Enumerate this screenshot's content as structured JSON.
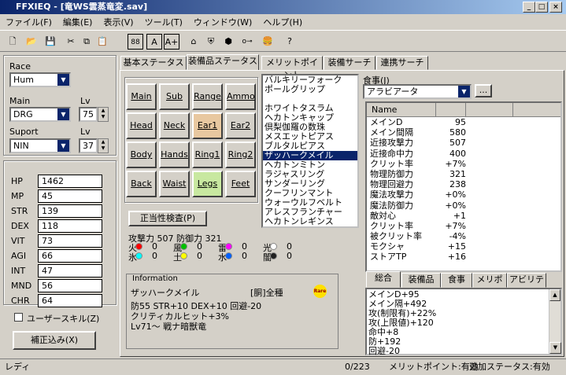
{
  "window": {
    "title": "FFXIEQ - [竜WS雲蒸竜変.sav]"
  },
  "menu": [
    "ファイル(F)",
    "編集(E)",
    "表示(V)",
    "ツール(T)",
    "ウィンドウ(W)",
    "ヘルプ(H)"
  ],
  "toolbar": {
    "b88": "88",
    "bA": "A",
    "bAplus": "A+"
  },
  "left": {
    "race_label": "Race",
    "race": "Hum",
    "main_label": "Main",
    "main": "DRG",
    "lv_label": "Lv",
    "main_lv": "75",
    "support_label": "Suport",
    "support": "NIN",
    "support_lv": "37",
    "stats": [
      {
        "k": "HP",
        "v": "1462"
      },
      {
        "k": "MP",
        "v": "45"
      },
      {
        "k": "STR",
        "v": "139"
      },
      {
        "k": "DEX",
        "v": "118"
      },
      {
        "k": "VIT",
        "v": "73"
      },
      {
        "k": "AGI",
        "v": "66"
      },
      {
        "k": "INT",
        "v": "47"
      },
      {
        "k": "MND",
        "v": "56"
      },
      {
        "k": "CHR",
        "v": "64"
      }
    ],
    "user_skill": "ユーザースキル(Z)",
    "correct_btn": "補正込み(X)"
  },
  "tabs": [
    "基本ステータス",
    "装備品ステータス",
    "メリットポイント",
    "装備サーチ",
    "連携サーチ"
  ],
  "slots": [
    [
      "Main",
      "Sub",
      "Range",
      "Ammo"
    ],
    [
      "Head",
      "Neck",
      "Ear1",
      "Ear2"
    ],
    [
      "Body",
      "Hands",
      "Ring1",
      "Ring2"
    ],
    [
      "Back",
      "Waist",
      "Legs",
      "Feet"
    ]
  ],
  "check_btn": "正当性検査(P)",
  "atk_def": "攻撃力 507 防御力 321",
  "elements": [
    {
      "n": "火",
      "v": "0",
      "c": "#ff0000"
    },
    {
      "n": "風",
      "v": "0",
      "c": "#00c000"
    },
    {
      "n": "雷",
      "v": "0",
      "c": "#ff00ff"
    },
    {
      "n": "光",
      "v": "0",
      "c": "#ffffff"
    },
    {
      "n": "氷",
      "v": "0",
      "c": "#00ffff"
    },
    {
      "n": "土",
      "v": "0",
      "c": "#ffff00"
    },
    {
      "n": "水",
      "v": "0",
      "c": "#0060ff"
    },
    {
      "n": "闇",
      "v": "0",
      "c": "#202020"
    }
  ],
  "info": {
    "label": "Information",
    "name": "ザッハークメイル",
    "type": "[胴]全種",
    "rare": "Rare",
    "desc1": "防55 STR+10 DEX+10 回避-20",
    "desc2": "クリティカルヒット+3%",
    "desc3": "Lv71～ 戦ナ暗獣竜"
  },
  "equip_list": [
    "バルキリーフォーク",
    "ポールグリップ",
    "",
    "ホワイトタスラム",
    "ヘカトンキャップ",
    "倶梨伽羅の数珠",
    "メスエットピアス",
    "ブルタルピアス",
    "ザッハークメイル",
    "ヘカトンミトン",
    "ラジャスリング",
    "サンダーリング",
    "クーフリンマント",
    "ウォーウルフベルト",
    "アレスフランチャー",
    "ヘカトンレギンス"
  ],
  "food": {
    "label": "食事(J)",
    "value": "アラビアータ",
    "more": "..."
  },
  "name_header": "Name",
  "stat_rows": [
    {
      "k": "メインD",
      "v": "95"
    },
    {
      "k": "メイン間隔",
      "v": "580"
    },
    {
      "k": "近接攻撃力",
      "v": "507"
    },
    {
      "k": "近接命中力",
      "v": "400"
    },
    {
      "k": "クリット率",
      "v": "+7%"
    },
    {
      "k": "物理防御力",
      "v": "321"
    },
    {
      "k": "物理回避力",
      "v": "238"
    },
    {
      "k": "魔法攻撃力",
      "v": "+0%"
    },
    {
      "k": "魔法防御力",
      "v": "+0%"
    },
    {
      "k": "敵対心",
      "v": "+1"
    },
    {
      "k": "クリット率",
      "v": "+7%"
    },
    {
      "k": "被クリット率",
      "v": "-4%"
    },
    {
      "k": "モクシャ",
      "v": "+15"
    },
    {
      "k": "ストアTP",
      "v": "+16"
    }
  ],
  "bottom_tabs": [
    "総合",
    "装備品",
    "食事",
    "メリポ",
    "アビリティ"
  ],
  "summary": [
    "メインD+95",
    "メイン隔+492",
    "攻(制限有)+22%",
    "攻(上限値)+120",
    "命中+8",
    "防+192",
    "回避-20"
  ],
  "status": {
    "left": "レディ",
    "count": "0/223",
    "merit": "メリットポイント:有効",
    "extra": "追加ステータス:有効"
  }
}
